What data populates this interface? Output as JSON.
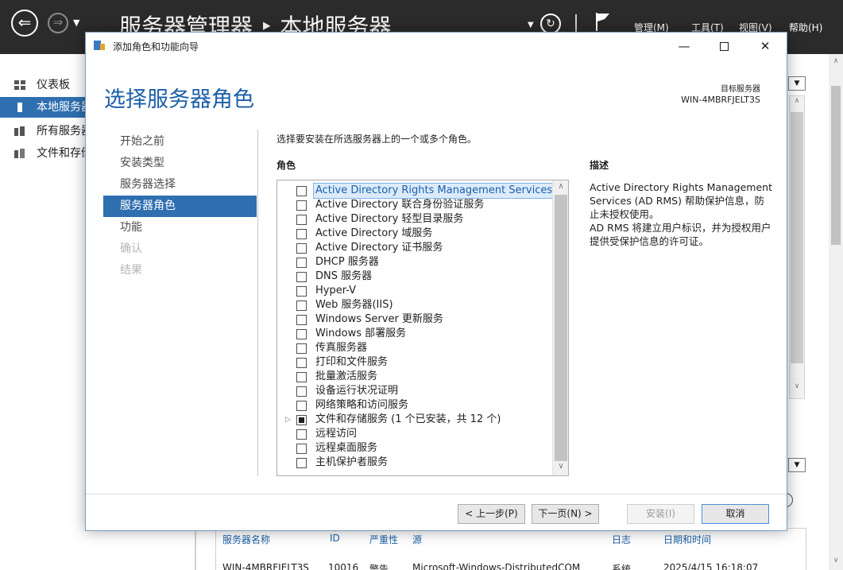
{
  "server_manager": {
    "title": "服务器管理器 ‣ 本地服务器",
    "menus": [
      "管理(M)",
      "工具(T)",
      "视图(V)",
      "帮助(H)"
    ],
    "sidebar": [
      {
        "label": "仪表板",
        "icon": "dashboard-icon",
        "active": false
      },
      {
        "label": "本地服务器",
        "icon": "server-icon",
        "active": true
      },
      {
        "label": "所有服务器",
        "icon": "servers-icon",
        "active": false
      },
      {
        "label": "文件和存储服务",
        "icon": "storage-icon",
        "active": false
      }
    ],
    "events": {
      "columns": [
        "服务器名称",
        "ID",
        "严重性",
        "源",
        "日志",
        "日期和时间"
      ],
      "row": [
        "WIN-4MBRFJELT3S",
        "10016",
        "警告",
        "Microsoft-Windows-DistributedCOM",
        "系统",
        "2025/4/15 16:18:07"
      ]
    }
  },
  "dialog": {
    "window_title": "添加角色和功能向导",
    "heading": "选择服务器角色",
    "target_label": "目标服务器",
    "target_server": "WIN-4MBRFJELT3S",
    "steps": [
      {
        "label": "开始之前",
        "state": "normal"
      },
      {
        "label": "安装类型",
        "state": "normal"
      },
      {
        "label": "服务器选择",
        "state": "normal"
      },
      {
        "label": "服务器角色",
        "state": "active"
      },
      {
        "label": "功能",
        "state": "normal"
      },
      {
        "label": "确认",
        "state": "disabled"
      },
      {
        "label": "结果",
        "state": "disabled"
      }
    ],
    "instruction": "选择要安装在所选服务器上的一个或多个角色。",
    "roles_header": "角色",
    "description_header": "描述",
    "roles": [
      {
        "label": "Active Directory Rights Management Services",
        "checked": false,
        "selected": true,
        "expandable": false
      },
      {
        "label": "Active Directory 联合身份验证服务",
        "checked": false,
        "selected": false,
        "expandable": false
      },
      {
        "label": "Active Directory 轻型目录服务",
        "checked": false,
        "selected": false,
        "expandable": false
      },
      {
        "label": "Active Directory 域服务",
        "checked": false,
        "selected": false,
        "expandable": false
      },
      {
        "label": "Active Directory 证书服务",
        "checked": false,
        "selected": false,
        "expandable": false
      },
      {
        "label": "DHCP 服务器",
        "checked": false,
        "selected": false,
        "expandable": false
      },
      {
        "label": "DNS 服务器",
        "checked": false,
        "selected": false,
        "expandable": false
      },
      {
        "label": "Hyper-V",
        "checked": false,
        "selected": false,
        "expandable": false
      },
      {
        "label": "Web 服务器(IIS)",
        "checked": false,
        "selected": false,
        "expandable": false
      },
      {
        "label": "Windows Server 更新服务",
        "checked": false,
        "selected": false,
        "expandable": false
      },
      {
        "label": "Windows 部署服务",
        "checked": false,
        "selected": false,
        "expandable": false
      },
      {
        "label": "传真服务器",
        "checked": false,
        "selected": false,
        "expandable": false
      },
      {
        "label": "打印和文件服务",
        "checked": false,
        "selected": false,
        "expandable": false
      },
      {
        "label": "批量激活服务",
        "checked": false,
        "selected": false,
        "expandable": false
      },
      {
        "label": "设备运行状况证明",
        "checked": false,
        "selected": false,
        "expandable": false
      },
      {
        "label": "网络策略和访问服务",
        "checked": false,
        "selected": false,
        "expandable": false
      },
      {
        "label": "文件和存储服务 (1 个已安装，共 12 个)",
        "checked": "partial",
        "selected": false,
        "expandable": true
      },
      {
        "label": "远程访问",
        "checked": false,
        "selected": false,
        "expandable": false
      },
      {
        "label": "远程桌面服务",
        "checked": false,
        "selected": false,
        "expandable": false
      },
      {
        "label": "主机保护者服务",
        "checked": false,
        "selected": false,
        "expandable": false
      }
    ],
    "description": [
      "Active Directory Rights Management Services (AD RMS) 帮助保护信息，防止未授权使用。",
      "AD RMS 将建立用户标识，并为授权用户提供受保护信息的许可证。"
    ],
    "buttons": {
      "previous": "< 上一步(P)",
      "next": "下一页(N) >",
      "install": "安装(I)",
      "cancel": "取消"
    }
  },
  "colors": {
    "accent": "#2f6fb0",
    "heading": "#1b5fa8",
    "header_bg": "#2b2b2b"
  }
}
